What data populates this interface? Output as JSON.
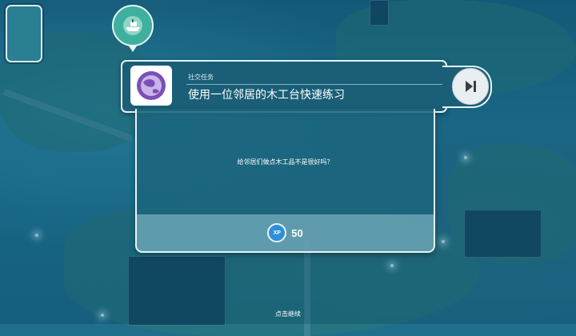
{
  "quest": {
    "category": "社交任务",
    "title": "使用一位邻居的木工台快速练习",
    "icon": "globe-icon"
  },
  "dialog": {
    "message": "给邻居们做点木工品不是很好吗？",
    "reward_badge": "XP",
    "reward_value": "50"
  },
  "hint": {
    "continue_label": "点击继续"
  },
  "icons": {
    "map_bubble": "boat-map-icon",
    "skip": "skip-forward-icon"
  },
  "colors": {
    "panel_dark": "#1a5f77",
    "panel_border": "#e6f3f7",
    "xp_blue": "#2f8fd6",
    "globe_purple": "#7b4fb8"
  }
}
